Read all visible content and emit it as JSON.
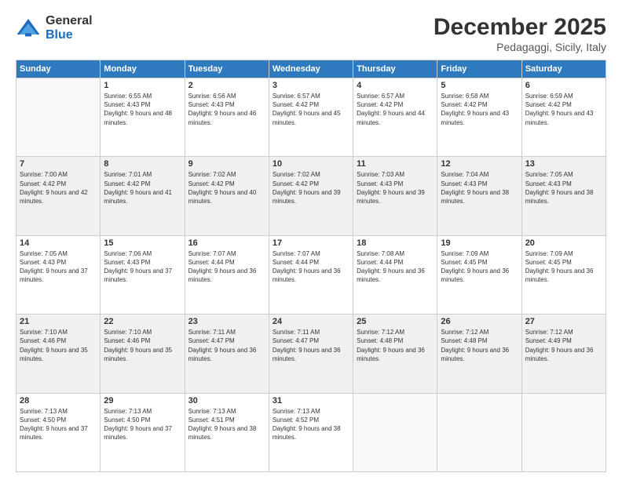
{
  "logo": {
    "general": "General",
    "blue": "Blue"
  },
  "title": "December 2025",
  "subtitle": "Pedagaggi, Sicily, Italy",
  "days_of_week": [
    "Sunday",
    "Monday",
    "Tuesday",
    "Wednesday",
    "Thursday",
    "Friday",
    "Saturday"
  ],
  "weeks": [
    [
      {
        "day": "",
        "sunrise": "",
        "sunset": "",
        "daylight": "",
        "empty": true
      },
      {
        "day": "1",
        "sunrise": "Sunrise: 6:55 AM",
        "sunset": "Sunset: 4:43 PM",
        "daylight": "Daylight: 9 hours and 48 minutes."
      },
      {
        "day": "2",
        "sunrise": "Sunrise: 6:56 AM",
        "sunset": "Sunset: 4:43 PM",
        "daylight": "Daylight: 9 hours and 46 minutes."
      },
      {
        "day": "3",
        "sunrise": "Sunrise: 6:57 AM",
        "sunset": "Sunset: 4:42 PM",
        "daylight": "Daylight: 9 hours and 45 minutes."
      },
      {
        "day": "4",
        "sunrise": "Sunrise: 6:57 AM",
        "sunset": "Sunset: 4:42 PM",
        "daylight": "Daylight: 9 hours and 44 minutes."
      },
      {
        "day": "5",
        "sunrise": "Sunrise: 6:58 AM",
        "sunset": "Sunset: 4:42 PM",
        "daylight": "Daylight: 9 hours and 43 minutes."
      },
      {
        "day": "6",
        "sunrise": "Sunrise: 6:59 AM",
        "sunset": "Sunset: 4:42 PM",
        "daylight": "Daylight: 9 hours and 43 minutes."
      }
    ],
    [
      {
        "day": "7",
        "sunrise": "Sunrise: 7:00 AM",
        "sunset": "Sunset: 4:42 PM",
        "daylight": "Daylight: 9 hours and 42 minutes."
      },
      {
        "day": "8",
        "sunrise": "Sunrise: 7:01 AM",
        "sunset": "Sunset: 4:42 PM",
        "daylight": "Daylight: 9 hours and 41 minutes."
      },
      {
        "day": "9",
        "sunrise": "Sunrise: 7:02 AM",
        "sunset": "Sunset: 4:42 PM",
        "daylight": "Daylight: 9 hours and 40 minutes."
      },
      {
        "day": "10",
        "sunrise": "Sunrise: 7:02 AM",
        "sunset": "Sunset: 4:42 PM",
        "daylight": "Daylight: 9 hours and 39 minutes."
      },
      {
        "day": "11",
        "sunrise": "Sunrise: 7:03 AM",
        "sunset": "Sunset: 4:43 PM",
        "daylight": "Daylight: 9 hours and 39 minutes."
      },
      {
        "day": "12",
        "sunrise": "Sunrise: 7:04 AM",
        "sunset": "Sunset: 4:43 PM",
        "daylight": "Daylight: 9 hours and 38 minutes."
      },
      {
        "day": "13",
        "sunrise": "Sunrise: 7:05 AM",
        "sunset": "Sunset: 4:43 PM",
        "daylight": "Daylight: 9 hours and 38 minutes."
      }
    ],
    [
      {
        "day": "14",
        "sunrise": "Sunrise: 7:05 AM",
        "sunset": "Sunset: 4:43 PM",
        "daylight": "Daylight: 9 hours and 37 minutes."
      },
      {
        "day": "15",
        "sunrise": "Sunrise: 7:06 AM",
        "sunset": "Sunset: 4:43 PM",
        "daylight": "Daylight: 9 hours and 37 minutes."
      },
      {
        "day": "16",
        "sunrise": "Sunrise: 7:07 AM",
        "sunset": "Sunset: 4:44 PM",
        "daylight": "Daylight: 9 hours and 36 minutes."
      },
      {
        "day": "17",
        "sunrise": "Sunrise: 7:07 AM",
        "sunset": "Sunset: 4:44 PM",
        "daylight": "Daylight: 9 hours and 36 minutes."
      },
      {
        "day": "18",
        "sunrise": "Sunrise: 7:08 AM",
        "sunset": "Sunset: 4:44 PM",
        "daylight": "Daylight: 9 hours and 36 minutes."
      },
      {
        "day": "19",
        "sunrise": "Sunrise: 7:09 AM",
        "sunset": "Sunset: 4:45 PM",
        "daylight": "Daylight: 9 hours and 36 minutes."
      },
      {
        "day": "20",
        "sunrise": "Sunrise: 7:09 AM",
        "sunset": "Sunset: 4:45 PM",
        "daylight": "Daylight: 9 hours and 36 minutes."
      }
    ],
    [
      {
        "day": "21",
        "sunrise": "Sunrise: 7:10 AM",
        "sunset": "Sunset: 4:46 PM",
        "daylight": "Daylight: 9 hours and 35 minutes."
      },
      {
        "day": "22",
        "sunrise": "Sunrise: 7:10 AM",
        "sunset": "Sunset: 4:46 PM",
        "daylight": "Daylight: 9 hours and 35 minutes."
      },
      {
        "day": "23",
        "sunrise": "Sunrise: 7:11 AM",
        "sunset": "Sunset: 4:47 PM",
        "daylight": "Daylight: 9 hours and 36 minutes."
      },
      {
        "day": "24",
        "sunrise": "Sunrise: 7:11 AM",
        "sunset": "Sunset: 4:47 PM",
        "daylight": "Daylight: 9 hours and 36 minutes."
      },
      {
        "day": "25",
        "sunrise": "Sunrise: 7:12 AM",
        "sunset": "Sunset: 4:48 PM",
        "daylight": "Daylight: 9 hours and 36 minutes."
      },
      {
        "day": "26",
        "sunrise": "Sunrise: 7:12 AM",
        "sunset": "Sunset: 4:48 PM",
        "daylight": "Daylight: 9 hours and 36 minutes."
      },
      {
        "day": "27",
        "sunrise": "Sunrise: 7:12 AM",
        "sunset": "Sunset: 4:49 PM",
        "daylight": "Daylight: 9 hours and 36 minutes."
      }
    ],
    [
      {
        "day": "28",
        "sunrise": "Sunrise: 7:13 AM",
        "sunset": "Sunset: 4:50 PM",
        "daylight": "Daylight: 9 hours and 37 minutes."
      },
      {
        "day": "29",
        "sunrise": "Sunrise: 7:13 AM",
        "sunset": "Sunset: 4:50 PM",
        "daylight": "Daylight: 9 hours and 37 minutes."
      },
      {
        "day": "30",
        "sunrise": "Sunrise: 7:13 AM",
        "sunset": "Sunset: 4:51 PM",
        "daylight": "Daylight: 9 hours and 38 minutes."
      },
      {
        "day": "31",
        "sunrise": "Sunrise: 7:13 AM",
        "sunset": "Sunset: 4:52 PM",
        "daylight": "Daylight: 9 hours and 38 minutes."
      },
      {
        "day": "",
        "empty": true
      },
      {
        "day": "",
        "empty": true
      },
      {
        "day": "",
        "empty": true
      }
    ]
  ]
}
